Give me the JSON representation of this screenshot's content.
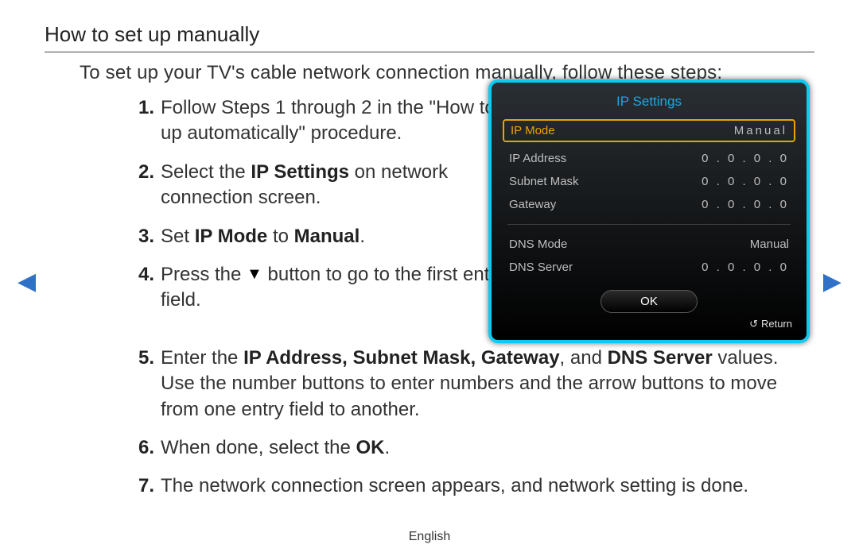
{
  "title": "How to set up manually",
  "intro": "To set up your TV's cable network connection manually, follow these steps:",
  "steps": [
    {
      "n": "1",
      "pre": "Follow Steps 1 through 2 in the \"How to set up automatically\" procedure."
    },
    {
      "n": "2",
      "pre": "Select the ",
      "hl": "IP Settings",
      "post": " on network connection screen."
    },
    {
      "n": "3",
      "pre": "Set ",
      "hl": "IP Mode",
      "mid": " to ",
      "hl2": "Manual",
      "post": "."
    },
    {
      "n": "4",
      "pre": "Press the ",
      "icon": "▼",
      "post": " button to go to the first entry field."
    },
    {
      "n": "5",
      "pre": "Enter the ",
      "hl": "IP Address, Subnet Mask, Gateway",
      "mid": ", and ",
      "hl2": "DNS Server",
      "post": " values. Use the number buttons to enter numbers and the arrow buttons to move from one entry field to another."
    },
    {
      "n": "6",
      "pre": "When done, select the ",
      "hl": "OK",
      "post": "."
    },
    {
      "n": "7",
      "pre": "The network connection screen appears, and network setting is done."
    }
  ],
  "panel": {
    "title": "IP Settings",
    "ipmode_label": "IP Mode",
    "ipmode_value": "Manual",
    "rows1": [
      {
        "label": "IP Address",
        "value": "0 . 0 . 0 . 0"
      },
      {
        "label": "Subnet Mask",
        "value": "0 . 0 . 0 . 0"
      },
      {
        "label": "Gateway",
        "value": "0 . 0 . 0 . 0"
      }
    ],
    "rows2": [
      {
        "label": "DNS Mode",
        "value": "Manual"
      },
      {
        "label": "DNS Server",
        "value": "0 . 0 . 0 . 0"
      }
    ],
    "ok": "OK",
    "return": "Return"
  },
  "nav": {
    "left": "◀",
    "right": "▶"
  },
  "footer": "English"
}
